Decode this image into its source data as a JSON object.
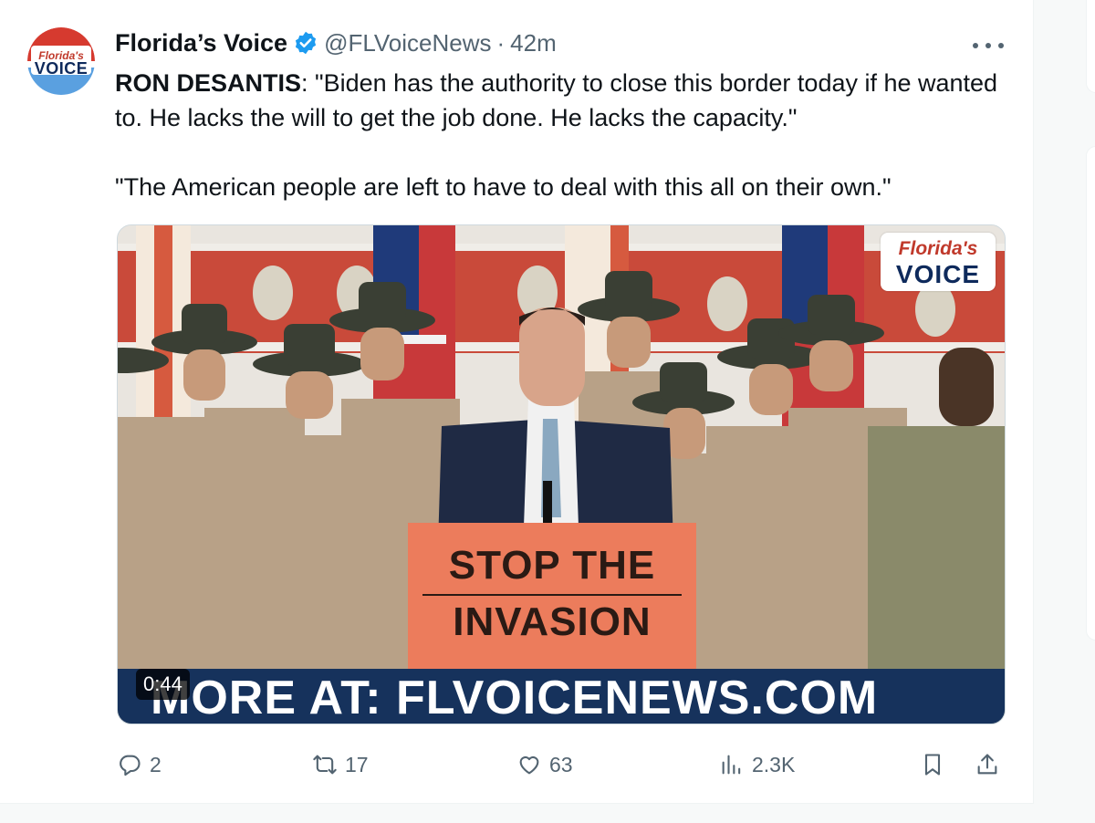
{
  "tweet": {
    "author_name": "Florida’s Voice",
    "handle": "@FLVoiceNews",
    "separator": "·",
    "time": "42m",
    "text_bold": "RON DESANTIS",
    "text_rest": ": \"Biden has the authority to close this border today if he wanted to. He lacks the will to get the job done. He lacks the capacity.\"",
    "text_second": "\"The American people are left to have to deal with this all on their own.\""
  },
  "avatar": {
    "line1": "Florida's",
    "line2": "VOICE"
  },
  "media": {
    "logo_line1": "Florida's",
    "logo_line2": "VOICE",
    "sign_line1": "STOP THE",
    "sign_line2": "INVASION",
    "banner": "MORE AT: FLVOICENEWS.COM",
    "duration": "0:44"
  },
  "actions": {
    "replies": "2",
    "reposts": "17",
    "likes": "63",
    "views": "2.3K"
  },
  "icons": {
    "verified": "verified-badge-icon",
    "more": "more-icon",
    "reply": "reply-icon",
    "repost": "repost-icon",
    "like": "heart-icon",
    "views": "views-icon",
    "bookmark": "bookmark-icon",
    "share": "share-icon"
  },
  "colors": {
    "verified_blue": "#1d9bf0",
    "secondary_text": "#536471",
    "banner_navy": "#16325c",
    "sign_orange": "#ec7c5c"
  }
}
